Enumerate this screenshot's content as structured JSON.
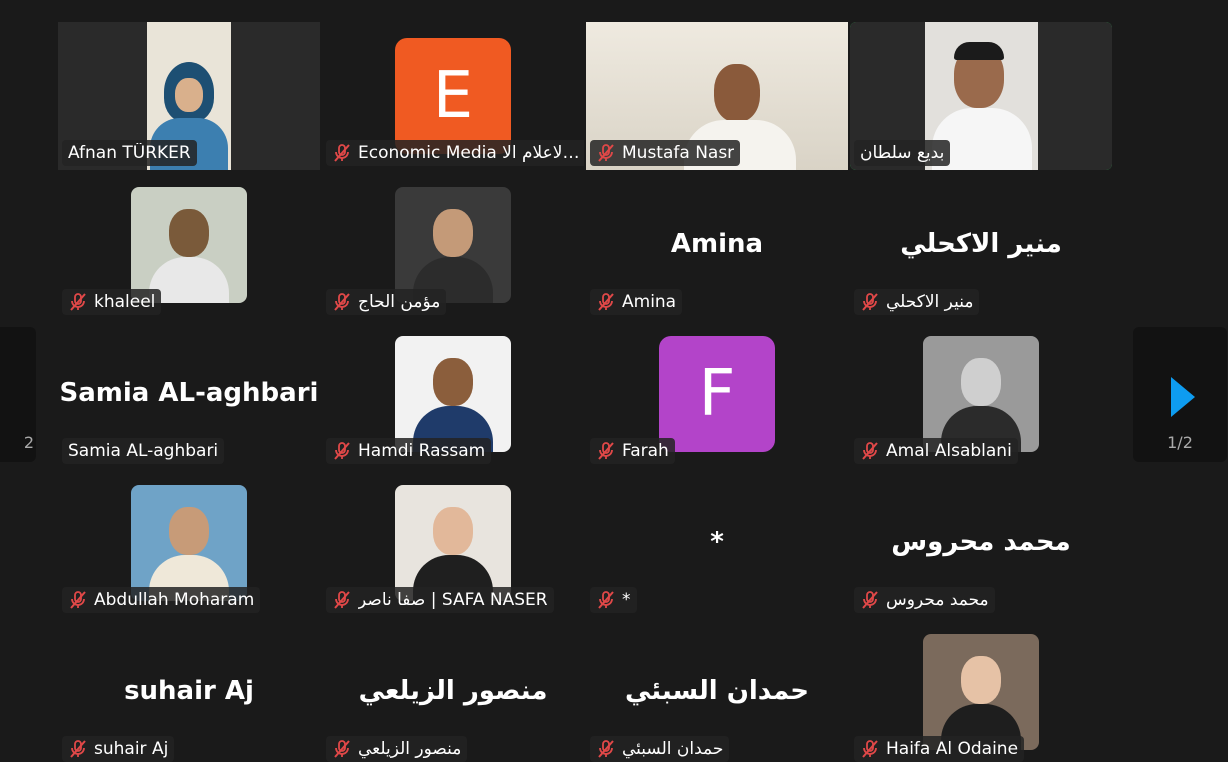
{
  "colors": {
    "active_border": "#23d959",
    "arrow": "#0e9cf0",
    "muted_mic": "#e04848"
  },
  "pagination": {
    "left_label": "2",
    "right_label": "1/2"
  },
  "tiles": [
    {
      "name": "Afnan TÜRKER",
      "muted": false,
      "kind": "video"
    },
    {
      "name": "Economic Media الاعلام الا...",
      "muted": true,
      "kind": "letter",
      "letter": "E",
      "color": "#f05a22"
    },
    {
      "name": "Mustafa Nasr",
      "muted": true,
      "kind": "video"
    },
    {
      "name": "بديع سلطان",
      "muted": false,
      "kind": "video",
      "active": true
    },
    {
      "name": "khaleel",
      "muted": true,
      "kind": "photo"
    },
    {
      "name": "مؤمن الحاج",
      "muted": true,
      "kind": "photo"
    },
    {
      "name": "Amina",
      "muted": true,
      "kind": "text",
      "display": "Amina"
    },
    {
      "name": "منير الاكحلي",
      "muted": true,
      "kind": "text",
      "display": "منير الاكحلي"
    },
    {
      "name": "Samia AL-aghbari",
      "muted": false,
      "kind": "text",
      "display": "Samia AL-aghbari"
    },
    {
      "name": "Hamdi Rassam",
      "muted": true,
      "kind": "photo"
    },
    {
      "name": "Farah",
      "muted": true,
      "kind": "letter",
      "letter": "F",
      "color": "#b344c9"
    },
    {
      "name": "Amal Alsablani",
      "muted": true,
      "kind": "photo"
    },
    {
      "name": "Abdullah Moharam",
      "muted": true,
      "kind": "photo"
    },
    {
      "name": "صفا ناصر | SAFA NASER",
      "muted": true,
      "kind": "photo"
    },
    {
      "name": "*",
      "muted": true,
      "kind": "text",
      "display": "*"
    },
    {
      "name": "محمد محروس",
      "muted": true,
      "kind": "text",
      "display": "محمد محروس"
    },
    {
      "name": "suhair Aj",
      "muted": true,
      "kind": "text",
      "display": "suhair Aj"
    },
    {
      "name": "منصور الزيلعي",
      "muted": true,
      "kind": "text",
      "display": "منصور الزيلعي"
    },
    {
      "name": "حمدان السبئي",
      "muted": true,
      "kind": "text",
      "display": "حمدان السبئي"
    },
    {
      "name": "Haifa Al Odaine",
      "muted": true,
      "kind": "photo"
    }
  ]
}
